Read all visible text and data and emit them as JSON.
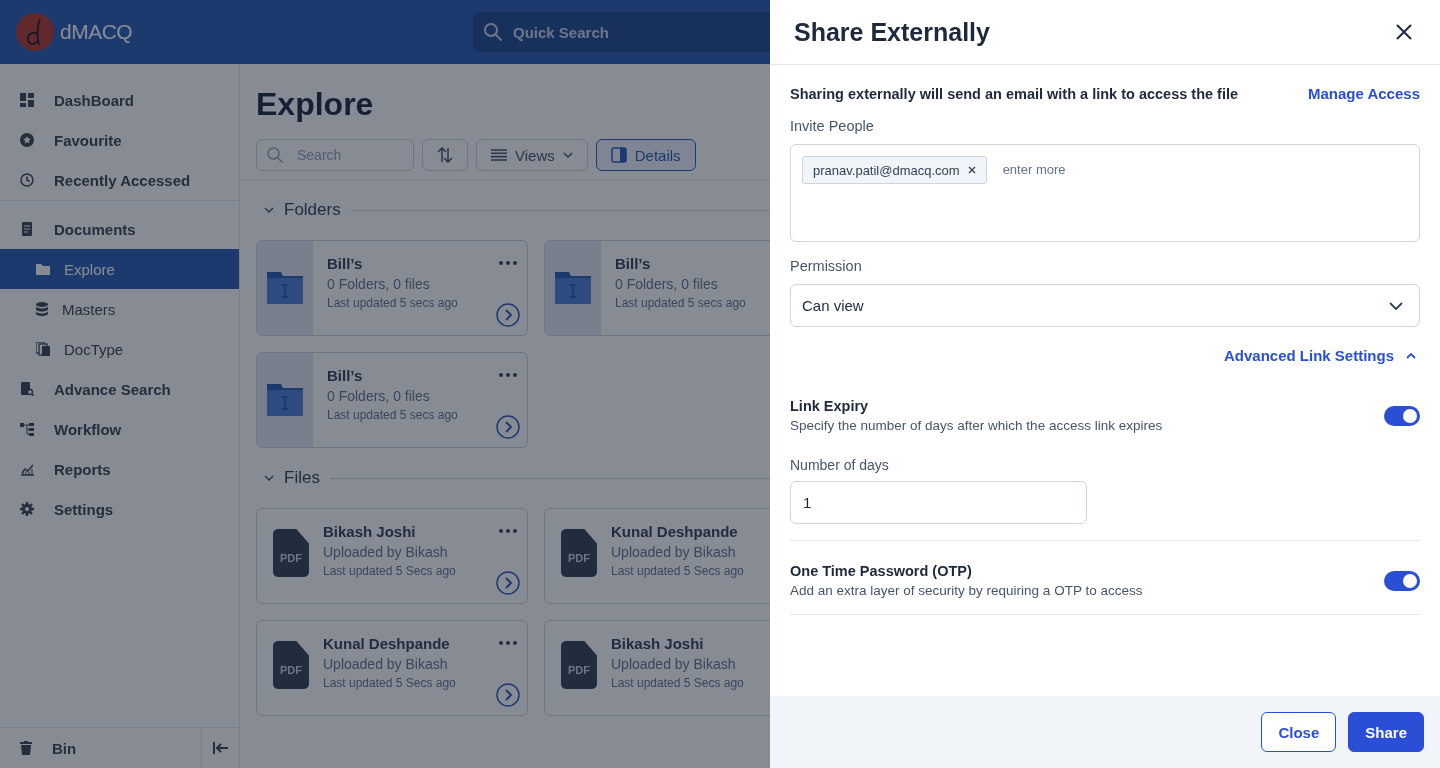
{
  "header": {
    "brand": "dMACQ",
    "search_placeholder": "Quick Search"
  },
  "sidebar": {
    "items": [
      {
        "label": "DashBoard",
        "selected": false
      },
      {
        "label": "Favourite",
        "selected": false
      },
      {
        "label": "Recently Accessed",
        "selected": false
      },
      {
        "label": "Documents",
        "selected": false,
        "children": [
          {
            "label": "Explore",
            "selected": true
          },
          {
            "label": "Masters",
            "selected": false
          },
          {
            "label": "DocType",
            "selected": false
          }
        ]
      },
      {
        "label": "Advance Search",
        "selected": false
      },
      {
        "label": "Workflow",
        "selected": false
      },
      {
        "label": "Reports",
        "selected": false
      },
      {
        "label": "Settings",
        "selected": false
      }
    ],
    "bottom": {
      "label": "Bin"
    }
  },
  "explore": {
    "title": "Explore",
    "search_placeholder": "Search",
    "views_label": "Views",
    "details_label": "Details",
    "details_active": true,
    "sections": [
      {
        "title": "Folders",
        "expanded": true,
        "kind": "folder",
        "cards": [
          {
            "name": "Bill’s",
            "line_1": "0 Folders, 0 files",
            "line_2": "Last updated 5 secs ago"
          },
          {
            "name": "Bill’s",
            "line_1": "0 Folders, 0 files",
            "line_2": "Last updated 5 secs ago"
          },
          {
            "name": "Bill’s",
            "line_1": "0 Folders, 0 files",
            "line_2": "Last updated 5 secs ago"
          }
        ]
      },
      {
        "title": "Files",
        "expanded": true,
        "kind": "file",
        "cards": [
          {
            "name": "Bikash Joshi",
            "badge": "PDF",
            "line_1": "Uploaded by Bikash",
            "line_2": "Last updated 5 Secs ago"
          },
          {
            "name": "Kunal Deshpande",
            "badge": "PDF",
            "line_1": "Uploaded by Bikash",
            "line_2": "Last updated 5 Secs ago"
          },
          {
            "name": "Kunal Deshpande",
            "badge": "PDF",
            "line_1": "Uploaded by Bikash",
            "line_2": "Last updated 5 Secs ago"
          },
          {
            "name": "Bikash Joshi",
            "badge": "PDF",
            "line_1": "Uploaded by Bikash",
            "line_2": "Last updated 5 Secs ago"
          }
        ]
      }
    ]
  },
  "share_dialog": {
    "title": "Share Externally",
    "description": "Sharing externally will send an email with a link to access the file",
    "manage_link": "Manage Access",
    "invite_label": "Invite People",
    "invitees": [
      "pranav.patil@dmacq.com"
    ],
    "invite_placeholder": "enter more",
    "permission_label": "Permission",
    "permission_value": "Can view",
    "advanced_label": "Advanced Link Settings",
    "advanced_expanded": true,
    "settings": [
      {
        "kind": "toggle",
        "title": "Link Expiry",
        "description": "Specify the number of days after which the access link expires",
        "on": true,
        "field_label": "Number of days",
        "field_value": "1"
      },
      {
        "kind": "toggle",
        "title": "One Time Password (OTP)",
        "description": "Add an extra layer of security by requiring a OTP to access",
        "on": true
      }
    ],
    "buttons": [
      {
        "label": "Close",
        "kind": "secondary"
      },
      {
        "label": "Share",
        "kind": "primary"
      }
    ]
  }
}
